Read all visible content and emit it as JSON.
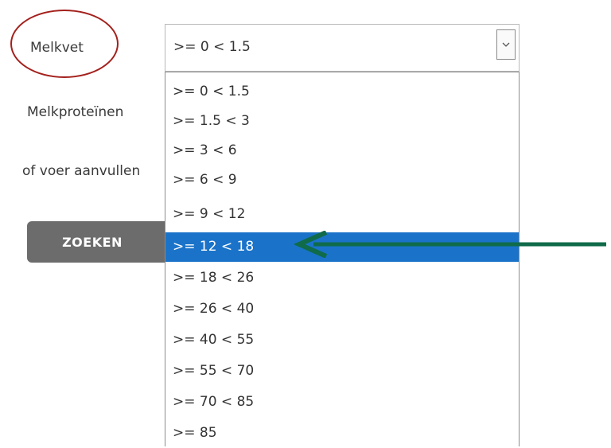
{
  "form": {
    "melkvet_label": "Melkvet",
    "melkproteinen_label": "Melkproteïnen",
    "aanvullen_label": "of voer aanvullen",
    "search_button": "ZOEKEN"
  },
  "select": {
    "value": ">= 0 < 1.5",
    "options": [
      ">= 0 < 1.5",
      ">= 1.5 < 3",
      ">= 3 < 6",
      ">= 6 < 9",
      ">= 9 < 12",
      ">= 12 < 18",
      ">= 18 < 26",
      ">= 26 < 40",
      ">= 40 < 55",
      ">= 55 < 70",
      ">= 70 < 85",
      ">= 85"
    ],
    "highlighted_index": 5
  },
  "annotations": {
    "circle_color": "#a3201c",
    "arrow_color": "#0f6b4a",
    "highlight_color": "#1a73c9"
  },
  "icons": {
    "dropdown_arrow": "chevron-down-icon",
    "pointer": "arrow-left-icon"
  }
}
